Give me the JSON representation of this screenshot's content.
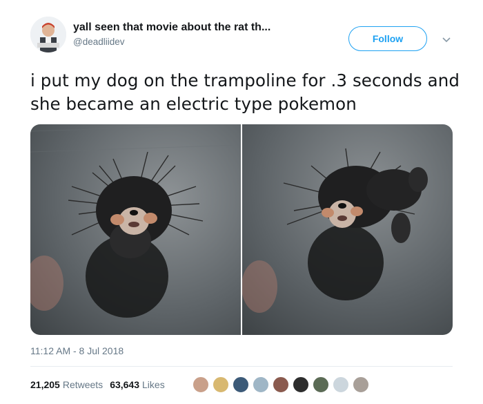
{
  "tweet": {
    "display_name": "yall seen that movie about the rat th...",
    "handle": "@deadliidev",
    "follow_label": "Follow",
    "text": "i put my dog on the trampoline for .3 seconds and she became an electric type pokemon",
    "timestamp": "11:12 AM - 8 Jul 2018",
    "retweets_count": "21,205",
    "retweets_label": "Retweets",
    "likes_count": "63,643",
    "likes_label": "Likes"
  },
  "icons": {
    "more": "chevron-down-icon",
    "avatar": "avatar"
  },
  "colors": {
    "accent": "#1da1f2",
    "secondary_text": "#657786",
    "primary_text": "#14171a"
  }
}
